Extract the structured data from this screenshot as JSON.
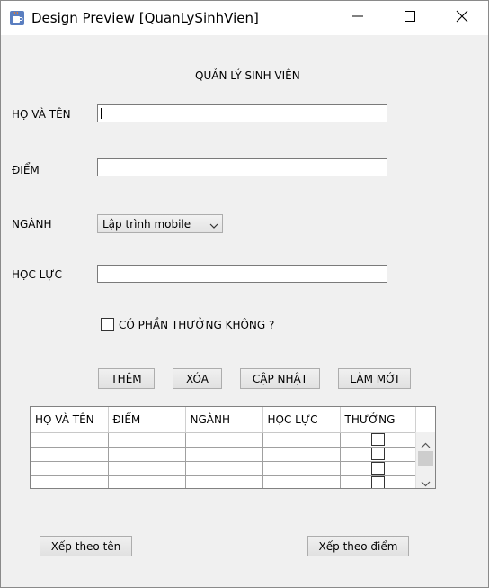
{
  "window": {
    "title": "Design Preview [QuanLySinhVien]"
  },
  "form": {
    "heading": "QUẢN LÝ SINH VIÊN",
    "name_label": "HỌ VÀ TÊN",
    "name_value": "",
    "score_label": "ĐIỂM",
    "score_value": "",
    "major_label": "NGÀNH",
    "major_selected": "Lập trình mobile",
    "rank_label": "HỌC LỰC",
    "rank_value": "",
    "reward_label": "CÓ PHẦN THƯỞNG KHÔNG ?",
    "reward_checked": false
  },
  "actions": {
    "add_label": "THÊM",
    "delete_label": "XÓA",
    "update_label": "CẬP NHẬT",
    "reset_label": "LÀM MỚI"
  },
  "table": {
    "columns": [
      "HỌ VÀ TÊN",
      "ĐIỂM",
      "NGÀNH",
      "HỌC LỰC",
      "THƯỞNG"
    ],
    "rows": [
      [
        "",
        "",
        "",
        "",
        false
      ],
      [
        "",
        "",
        "",
        "",
        false
      ],
      [
        "",
        "",
        "",
        "",
        false
      ],
      [
        "",
        "",
        "",
        "",
        false
      ]
    ]
  },
  "sort": {
    "by_name_label": "Xếp theo tên",
    "by_score_label": "Xếp theo điểm"
  },
  "icons": {
    "app": "java-coffee-icon",
    "minimize": "minimize-icon",
    "maximize": "maximize-icon",
    "close": "close-icon",
    "combo_arrow": "chevron-down-icon",
    "scroll_up": "chevron-up-icon",
    "scroll_down": "chevron-down-icon"
  }
}
